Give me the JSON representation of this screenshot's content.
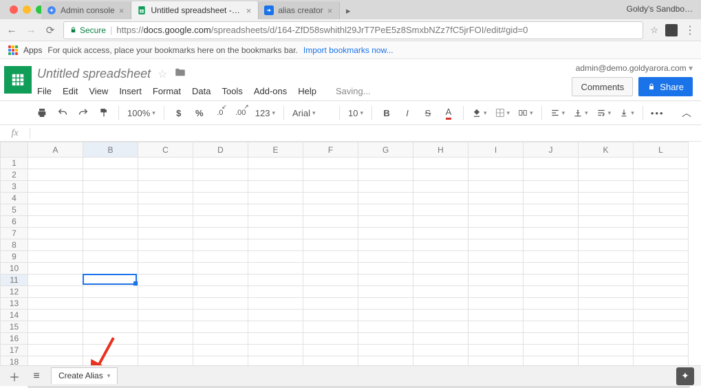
{
  "browser": {
    "profile_name": "Goldy's Sandbo…",
    "tabs": [
      {
        "title": "Admin console",
        "favicon_color": "#4285f4"
      },
      {
        "title": "Untitled spreadsheet - Google",
        "favicon_color": "#0f9d58"
      },
      {
        "title": "alias creator",
        "favicon_color": "#1a73e8"
      }
    ],
    "active_tab_index": 1,
    "secure_label": "Secure",
    "url_prefix": "https://",
    "url_host": "docs.google.com",
    "url_path": "/spreadsheets/d/164-ZfD58swhithl29JrT7PeE5z8SmxbNZz7fC5jrFOI/edit#gid=0",
    "bookmarks": {
      "apps_label": "Apps",
      "hint": "For quick access, place your bookmarks here on the bookmarks bar.",
      "import_label": "Import bookmarks now..."
    }
  },
  "sheets": {
    "doc_title": "Untitled spreadsheet",
    "account_email": "admin@demo.goldyarora.com",
    "buttons": {
      "comments": "Comments",
      "share": "Share"
    },
    "menubar": [
      "File",
      "Edit",
      "View",
      "Insert",
      "Format",
      "Data",
      "Tools",
      "Add-ons",
      "Help"
    ],
    "saving_label": "Saving...",
    "toolbar": {
      "zoom": "100%",
      "decimal_dec": ".0",
      "decimal_inc": ".00",
      "number_format": "123",
      "font": "Arial",
      "font_size": "10"
    },
    "fx_label": "fx",
    "columns": [
      "A",
      "B",
      "C",
      "D",
      "E",
      "F",
      "G",
      "H",
      "I",
      "J",
      "K",
      "L"
    ],
    "row_count": 19,
    "active_cell": {
      "row": 11,
      "col": "B"
    },
    "sheet_tab": "Create Alias"
  }
}
